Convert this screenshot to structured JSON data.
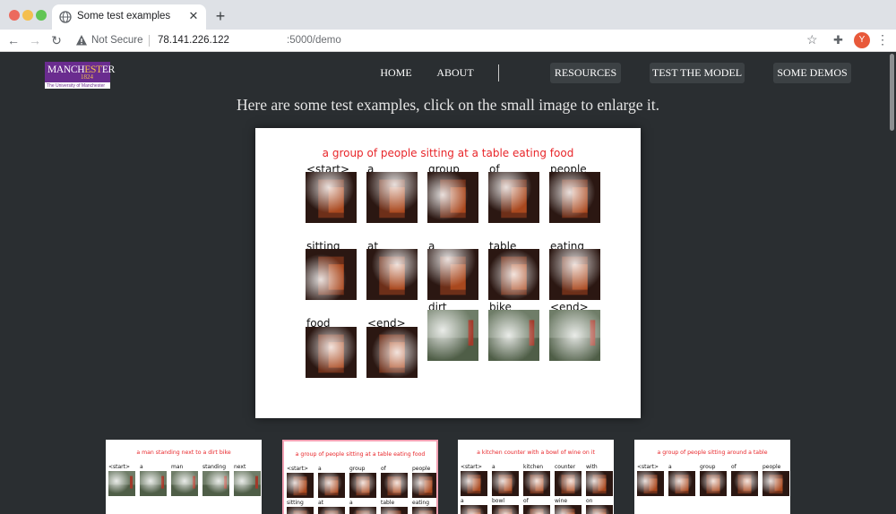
{
  "browser": {
    "tab_title": "Some test examples",
    "security_label": "Not Secure",
    "url_host": "78.141.226.122",
    "url_path": ":5000/demo",
    "profile_initial": "Y"
  },
  "logo": {
    "name_part1": "MANCH",
    "name_part2": "EST",
    "name_part3": "ER",
    "year": "1824",
    "subtitle": "The University of Manchester"
  },
  "nav": {
    "home": "HOME",
    "about": "ABOUT",
    "resources": "RESOURCES",
    "test_model": "TEST THE MODEL",
    "demos": "SOME DEMOS"
  },
  "headline": "Here are some test examples, click on the small image to enlarge it.",
  "enlarged": {
    "caption": "a group of people sitting at a table eating food",
    "words": [
      "<start>",
      "a",
      "group",
      "of",
      "people",
      "sitting",
      "at",
      "a",
      "table",
      "eating",
      "food",
      "<end>",
      "dirt",
      "bike",
      "<end>"
    ]
  },
  "thumbnails": [
    {
      "caption": "a man standing next to a dirt bike",
      "words": [
        "<start>",
        "a",
        "man",
        "standing",
        "next"
      ],
      "active": false
    },
    {
      "caption": "a group of people sitting at a table eating food",
      "words": [
        "<start>",
        "a",
        "group",
        "of",
        "people",
        "sitting",
        "at",
        "a",
        "table",
        "eating"
      ],
      "active": true
    },
    {
      "caption": "a kitchen counter with a bowl of wine on it",
      "words": [
        "<start>",
        "a",
        "kitchen",
        "counter",
        "with",
        "a",
        "bowl",
        "of",
        "wine",
        "on"
      ],
      "active": false
    },
    {
      "caption": "a group of people sitting around a table",
      "words": [
        "<start>",
        "a",
        "group",
        "of",
        "people"
      ],
      "active": false
    }
  ],
  "colors": {
    "page_bg": "#2a2e31",
    "caption_red": "#e8262a",
    "nav_box": "#3c4144",
    "logo_purple": "#6a2c8f",
    "active_border": "#f2a1b3"
  }
}
